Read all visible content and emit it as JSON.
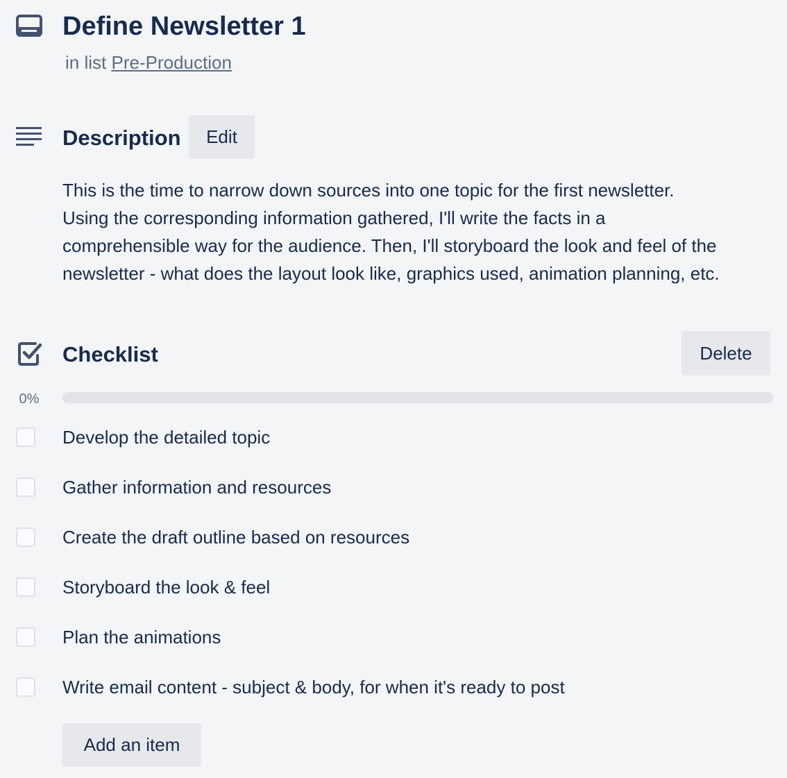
{
  "card": {
    "icon": "card-icon",
    "title": "Define Newsletter 1",
    "in_list_prefix": "in list",
    "list_name": "Pre-Production"
  },
  "description": {
    "icon": "description-lines-icon",
    "heading": "Description",
    "edit_label": "Edit",
    "text": "This is the time to narrow down sources into one topic for the first newsletter.\nUsing the corresponding information gathered, I'll write the facts in a\ncomprehensible way for the audience. Then, I'll storyboard the look and feel of the\nnewsletter - what does the layout look like, graphics used, animation planning, etc."
  },
  "checklist": {
    "icon": "checkbox-checked-icon",
    "heading": "Checklist",
    "delete_label": "Delete",
    "progress_label": "0%",
    "progress_fraction": 0,
    "items": [
      {
        "text": "Develop the detailed topic",
        "checked": false
      },
      {
        "text": "Gather information and resources",
        "checked": false
      },
      {
        "text": "Create the draft outline based on resources",
        "checked": false
      },
      {
        "text": "Storyboard the look & feel",
        "checked": false
      },
      {
        "text": "Plan the animations",
        "checked": false
      },
      {
        "text": "Write email content - subject & body, for when it's ready to post",
        "checked": false
      }
    ],
    "add_item_label": "Add an item"
  },
  "colors": {
    "background": "#f4f5f7",
    "text": "#172b4d",
    "muted": "#5e6c84",
    "button": "#e6e8ec",
    "progress_track": "#e2e4e9"
  }
}
